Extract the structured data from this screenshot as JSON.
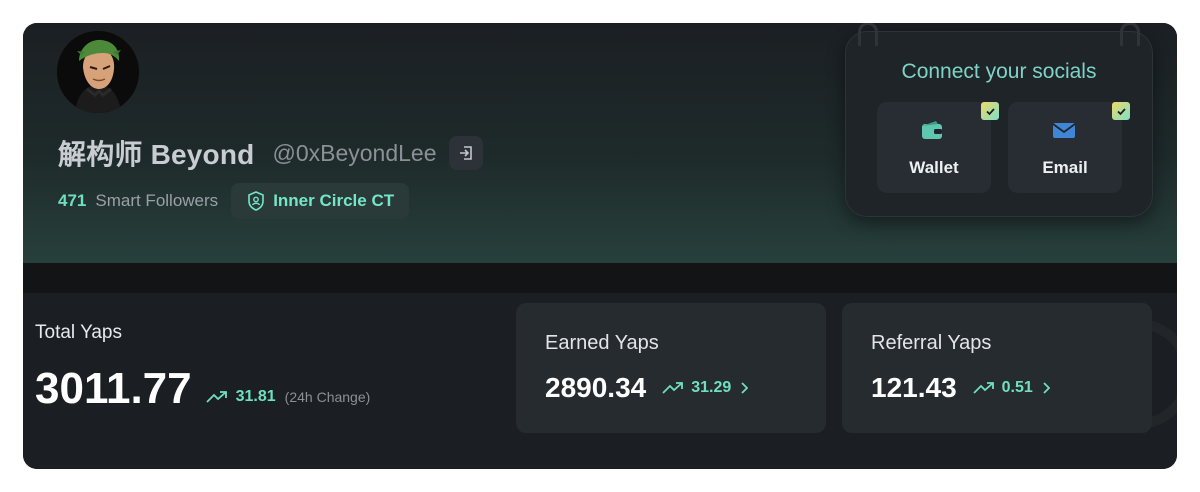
{
  "profile": {
    "display_name": "解构师 Beyond",
    "handle": "@0xBeyondLee",
    "smart_followers_count": "471",
    "smart_followers_label": "Smart Followers",
    "badge_label": "Inner Circle CT"
  },
  "socials": {
    "title": "Connect your socials",
    "items": [
      {
        "label": "Wallet",
        "icon": "wallet-icon",
        "connected": true
      },
      {
        "label": "Email",
        "icon": "email-icon",
        "connected": true
      }
    ]
  },
  "total_yaps": {
    "label": "Total Yaps",
    "value": "3011.77",
    "change": "31.81",
    "change_note": "(24h Change)"
  },
  "earned_yaps": {
    "label": "Earned Yaps",
    "value": "2890.34",
    "change": "31.29"
  },
  "referral_yaps": {
    "label": "Referral Yaps",
    "value": "121.43",
    "change": "0.51"
  },
  "colors": {
    "accent": "#6ee0c0",
    "card_bg": "#1a1e22",
    "tile_bg": "#262b30"
  }
}
